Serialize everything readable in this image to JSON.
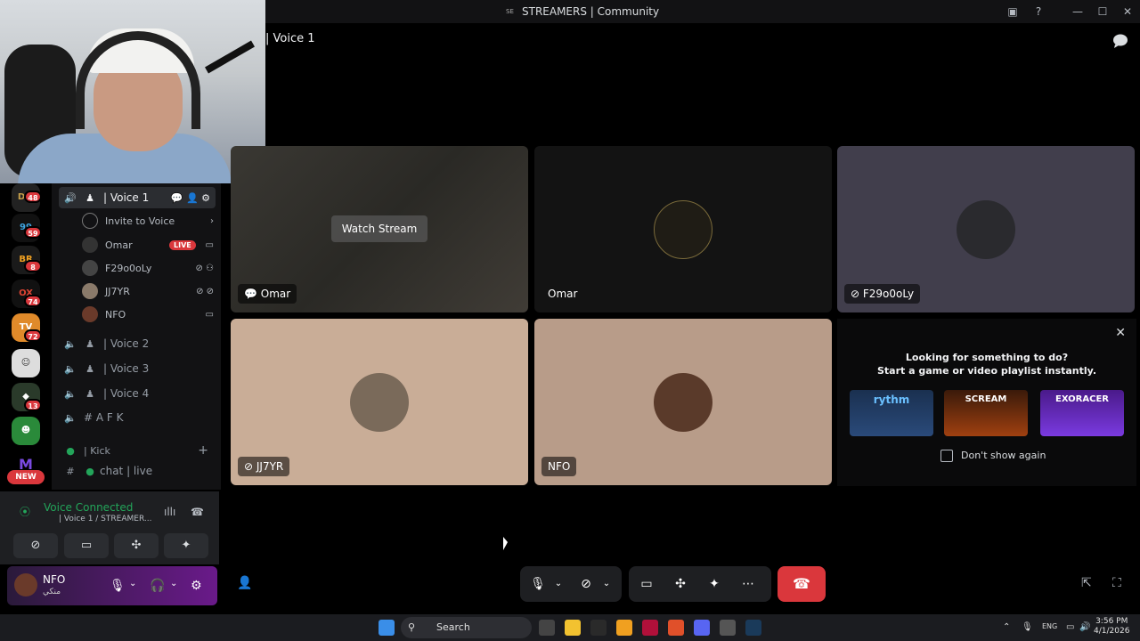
{
  "window": {
    "title": "STREAMERS | Community",
    "server_glyph": "SE"
  },
  "header": {
    "channel": "| Voice 1"
  },
  "servers": {
    "badges": [
      "48",
      "59",
      "8",
      "74",
      "72",
      "13"
    ],
    "new_label": "NEW"
  },
  "channels": {
    "active": "| Voice 1",
    "invite": "Invite to Voice",
    "members": [
      {
        "name": "Omar",
        "live": "LIVE"
      },
      {
        "name": "F29o0oLy",
        "live": ""
      },
      {
        "name": "JJ7YR",
        "live": ""
      },
      {
        "name": "NFO",
        "live": ""
      }
    ],
    "others": [
      "| Voice 2",
      "| Voice 3",
      "| Voice 4",
      "# A F K"
    ],
    "category": "| Kick",
    "text_channel": "chat | live"
  },
  "voice_panel": {
    "status": "Voice Connected",
    "sub": "| Voice 1 / STREAMER..."
  },
  "user": {
    "name": "NFO",
    "sub": "منكي"
  },
  "tiles": [
    {
      "label": "Omar",
      "watch": "Watch Stream"
    },
    {
      "label": "Omar"
    },
    {
      "label": "F29o0oLy"
    },
    {
      "label": "JJ7YR"
    },
    {
      "label": "NFO"
    }
  ],
  "activity": {
    "title_line1": "Looking for something to do?",
    "title_line2": "Start a game or video playlist instantly.",
    "cards": [
      "rythm",
      "SCREAM",
      "EXORACER"
    ],
    "dont_show": "Don't show again"
  },
  "taskbar": {
    "search": "Search",
    "lang": "ENG",
    "time": "3:56 PM",
    "date": "4/1/2026"
  },
  "colors": {
    "accent_red": "#da373c",
    "green": "#23a55a",
    "tile_tan": "#c9ad97",
    "tile_brown": "#b89c89",
    "tile_purple": "#413e4c"
  }
}
